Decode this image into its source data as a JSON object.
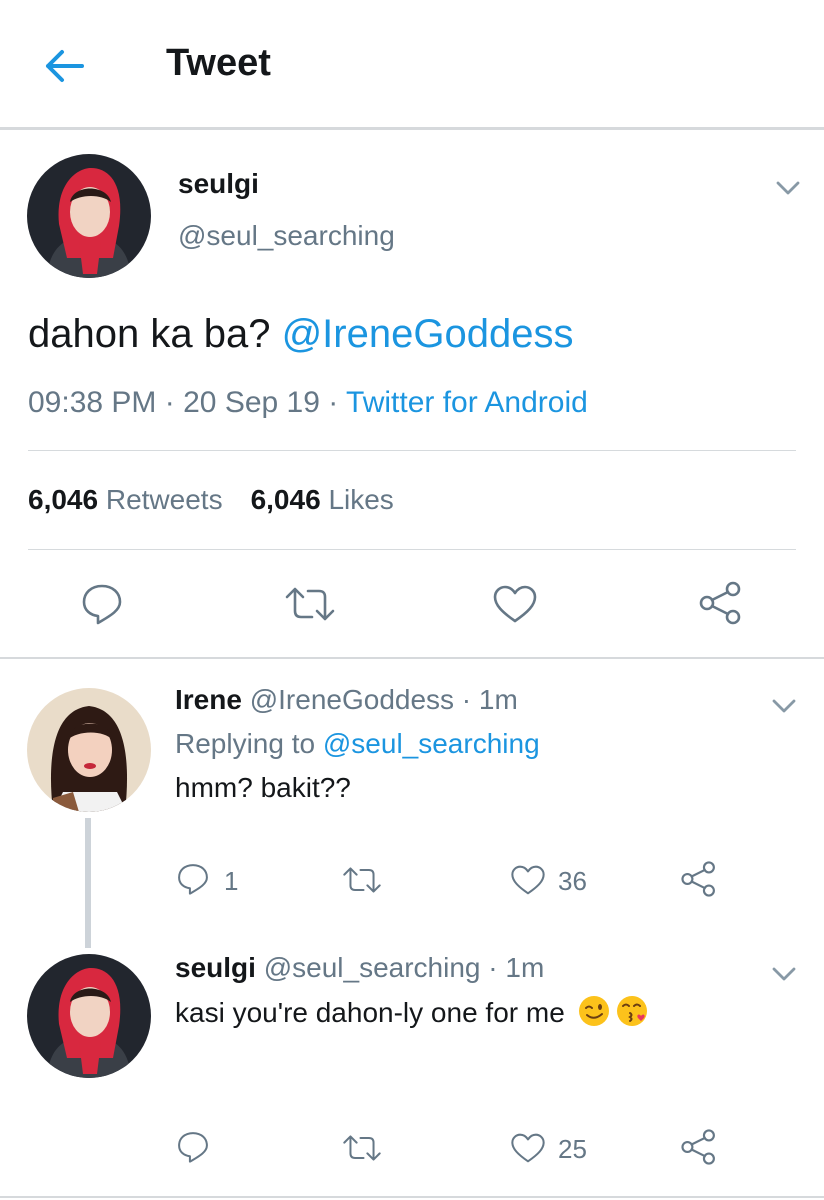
{
  "header": {
    "title": "Tweet"
  },
  "tweet": {
    "name": "seulgi",
    "handle": "@seul_searching",
    "text_plain": "dahon ka ba? ",
    "text_mention": "@IreneGoddess",
    "time": "09:38 PM",
    "date": "20 Sep 19",
    "source": "Twitter for Android",
    "retweets_count": "6,046",
    "retweets_label": "Retweets",
    "likes_count": "6,046",
    "likes_label": "Likes"
  },
  "replies": [
    {
      "name": "Irene",
      "handle": "@IreneGoddess",
      "time": "1m",
      "replying_prefix": "Replying to ",
      "replying_to": "@seul_searching",
      "text": "hmm? bakit??",
      "reply_count": "1",
      "like_count": "36"
    },
    {
      "name": "seulgi",
      "handle": "@seul_searching",
      "time": "1m",
      "text": "kasi you're dahon-ly one for me",
      "emojis": [
        "winking-face",
        "face-blowing-kiss"
      ],
      "like_count": "25"
    }
  ],
  "colors": {
    "accent": "#1b95e0",
    "muted": "#657786",
    "text": "#14171a",
    "divider": "#d6dadd"
  }
}
